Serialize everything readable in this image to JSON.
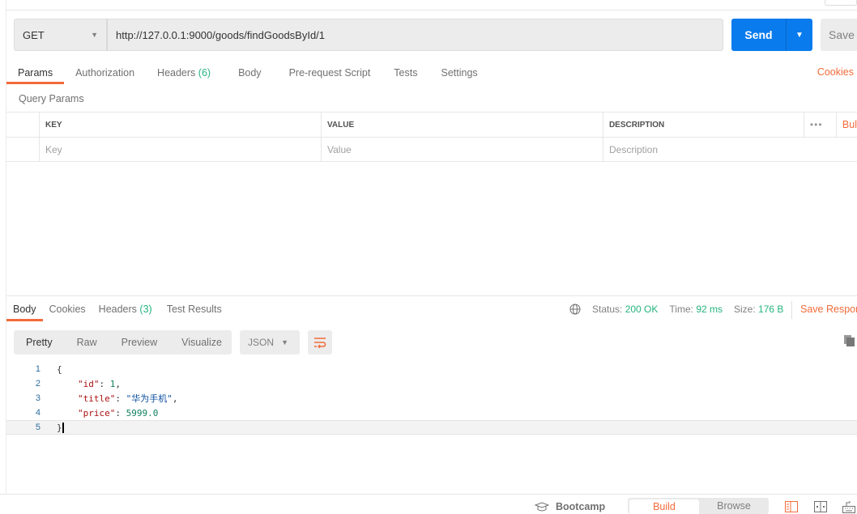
{
  "request": {
    "method": "GET",
    "url": "http://127.0.0.1:9000/goods/findGoodsById/1",
    "send_label": "Send",
    "save_label": "Save"
  },
  "req_tabs": [
    {
      "label": "Params"
    },
    {
      "label": "Authorization"
    },
    {
      "label": "Headers",
      "count": "(6)"
    },
    {
      "label": "Body"
    },
    {
      "label": "Pre-request Script"
    },
    {
      "label": "Tests"
    },
    {
      "label": "Settings"
    }
  ],
  "cookies_link": "Cookies",
  "query_params": {
    "title": "Query Params",
    "headers": [
      "KEY",
      "VALUE",
      "DESCRIPTION"
    ],
    "bulk_edit": "Bul",
    "placeholders": {
      "key": "Key",
      "value": "Value",
      "description": "Description"
    }
  },
  "response": {
    "tabs": [
      {
        "label": "Body"
      },
      {
        "label": "Cookies"
      },
      {
        "label": "Headers",
        "count": "(3)"
      },
      {
        "label": "Test Results"
      }
    ],
    "status_label": "Status:",
    "status": "200 OK",
    "time_label": "Time:",
    "time": "92 ms",
    "size_label": "Size:",
    "size": "176 B",
    "save_response": "Save Respor",
    "formats": [
      "Pretty",
      "Raw",
      "Preview",
      "Visualize"
    ],
    "language": "JSON",
    "lines": [
      "1",
      "2",
      "3",
      "4",
      "5"
    ],
    "body": {
      "open": "{",
      "k1": "\"id\"",
      "v1": "1",
      "k2": "\"title\"",
      "v2": "\"华为手机\"",
      "k3": "\"price\"",
      "v3": "5999.0",
      "close": "}"
    }
  },
  "footer": {
    "bootcamp": "Bootcamp",
    "build": "Build",
    "browse": "Browse"
  },
  "colors": {
    "accent": "#f26b3a",
    "primary": "#097bed",
    "success": "#26b47f"
  }
}
